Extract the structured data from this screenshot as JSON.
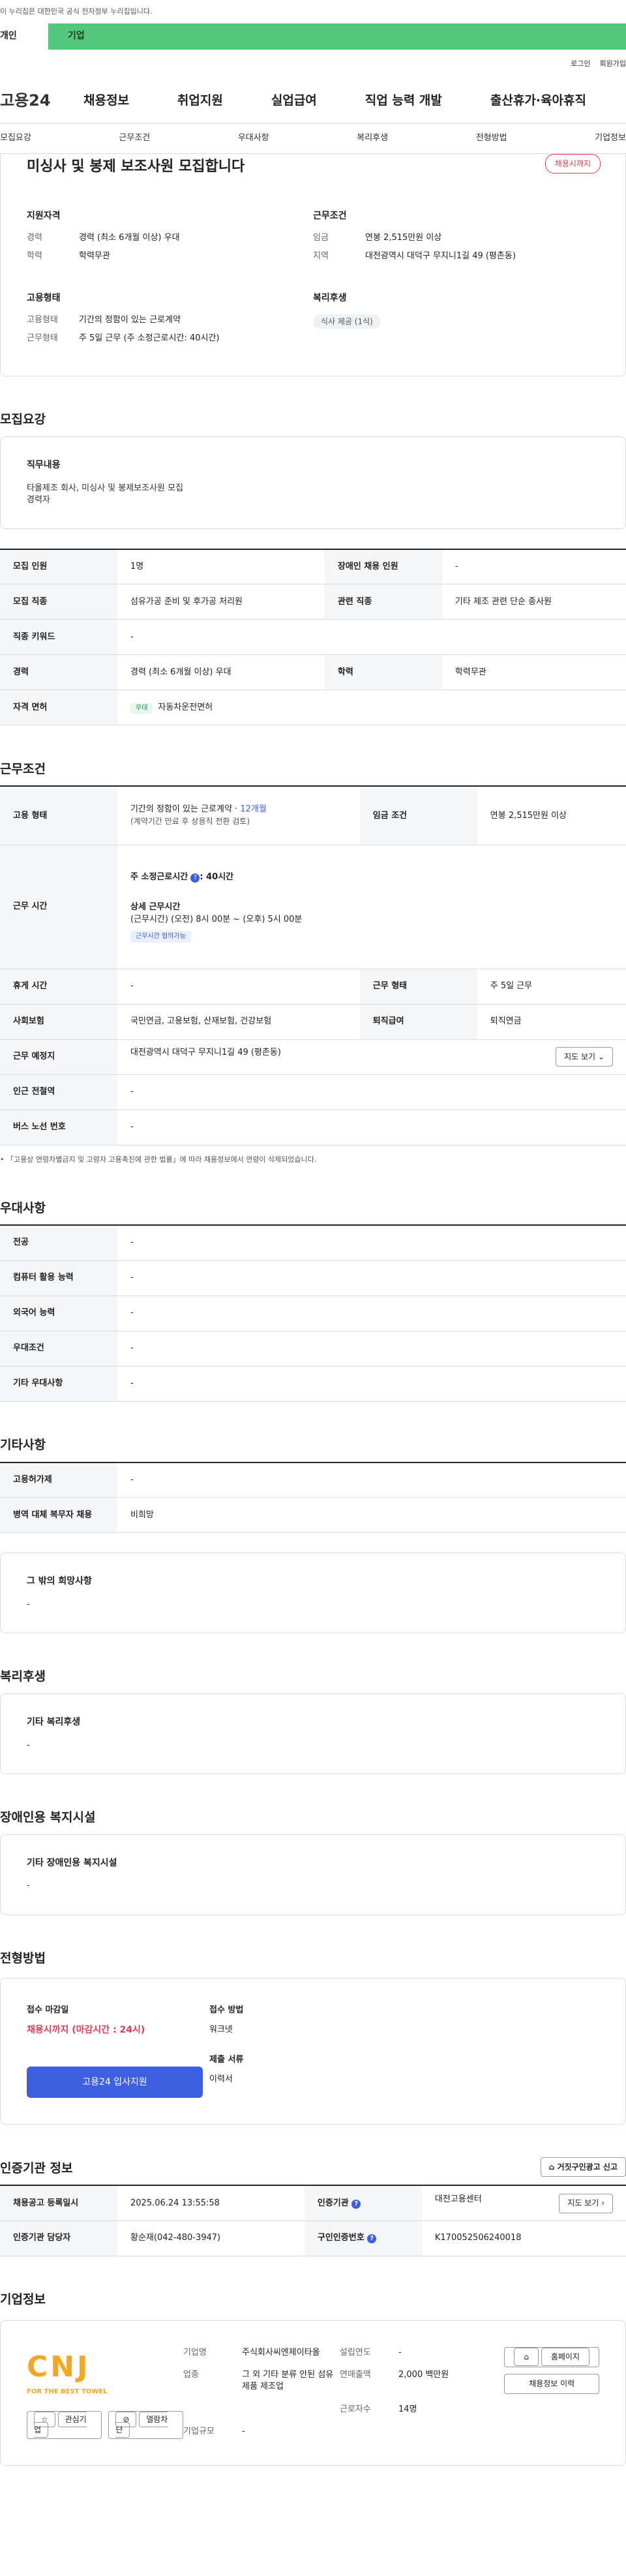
{
  "notice": "이 누리집은 대한민국 공식 전자정부 누리집입니다.",
  "tabs": [
    "개인",
    "기업"
  ],
  "util": {
    "login": "로그인",
    "join": "회원가입"
  },
  "gnb": {
    "logo": "고용24",
    "items": [
      "채용정보",
      "취업지원",
      "실업급여",
      "직업 능력 개발",
      "출산휴가·육아휴직"
    ]
  },
  "secnav": [
    "모집요강",
    "근무조건",
    "우대사항",
    "복리후생",
    "전형방법",
    "기업정보"
  ],
  "summary": {
    "title": "미싱사 및 봉제 보조사원 모집합니다",
    "badge": "채용시까지",
    "qual_title": "지원자격",
    "qual": [
      {
        "k": "경력",
        "v": "경력 (최소 6개월 이상) 우대"
      },
      {
        "k": "학력",
        "v": "학력무관"
      }
    ],
    "work_title": "근무조건",
    "work": [
      {
        "k": "임금",
        "v": "연봉 2,515만원 이상"
      },
      {
        "k": "지역",
        "v": "대전광역시 대덕구 무지니1길 49 (평촌동)"
      }
    ],
    "emp_title": "고용형태",
    "emp": [
      {
        "k": "고용형태",
        "v": "기간의 정함이 있는 근로계약"
      },
      {
        "k": "근무형태",
        "v": "주 5일 근무 (주 소정근로시간: 40시간)"
      }
    ],
    "welfare_title": "복리후생",
    "welfare_chip": "식사 제공 (1식)"
  },
  "recruit": {
    "heading": "모집요강",
    "duty_title": "직무내용",
    "duty_lines": [
      "타올제조 회사, 미싱사 및 봉제보조사원 모집",
      "경력자"
    ],
    "rows": [
      [
        {
          "k": "모집 인원",
          "v": "1명"
        },
        {
          "k": "장애인 채용 인원",
          "v": "-"
        }
      ],
      [
        {
          "k": "모집 직종",
          "v": "섬유가공 준비 및 후가공 처리원"
        },
        {
          "k": "관련 직종",
          "v": "기타 제조 관련 단순 종사원"
        }
      ],
      [
        {
          "k": "직종 키워드",
          "v": "-"
        }
      ],
      [
        {
          "k": "경력",
          "v": "경력 (최소 6개월 이상) 우대"
        },
        {
          "k": "학력",
          "v": "학력무관"
        }
      ],
      [
        {
          "k": "자격 면허",
          "v": "자동차운전면허",
          "tag": "우대"
        }
      ]
    ]
  },
  "conditions": {
    "heading": "근무조건",
    "emp_type_k": "고용 형태",
    "emp_type_v": "기간의 정함이 있는 근로계약 · ",
    "emp_type_link": "12개월",
    "emp_type_note": "(계약기간 만료 후 상용직 전환 검토)",
    "wage_k": "임금 조건",
    "wage_v": "연봉 2,515만원 이상",
    "hours_k": "근무 시간",
    "hours_main": "주 소정근로시간",
    "hours_main_v": ": 40시간",
    "hours_detail_t": "상세 근무시간",
    "hours_detail_v": "(근무시간) (오전) 8시 00분 ~ (오후) 5시 00분",
    "hours_tag": "근무시간 협의가능",
    "rest_k": "휴게 시간",
    "rest_v": "-",
    "form_k": "근무 형태",
    "form_v": "주 5일 근무",
    "ins_k": "사회보험",
    "ins_v": "국민연금, 고용보험, 산재보험, 건강보험",
    "ret_k": "퇴직급여",
    "ret_v": "퇴직연금",
    "loc_k": "근무 예정지",
    "loc_v": "대전광역시 대덕구 무지니1길 49 (평촌동)",
    "map_btn": "지도 보기",
    "sub_k": "인근 전철역",
    "sub_v": "-",
    "bus_k": "버스 노선 번호",
    "bus_v": "-",
    "note": "「고용상 연령차별금지 및 고령자 고용촉진에 관한 법률」에 따라 채용정보에서 연령이 삭제되었습니다."
  },
  "pref": {
    "heading": "우대사항",
    "rows": [
      {
        "k": "전공",
        "v": "-"
      },
      {
        "k": "컴퓨터 활용 능력",
        "v": "-"
      },
      {
        "k": "외국어 능력",
        "v": "-"
      },
      {
        "k": "우대조건",
        "v": "-"
      },
      {
        "k": "기타 우대사항",
        "v": "-"
      }
    ]
  },
  "etc": {
    "heading": "기타사항",
    "rows": [
      {
        "k": "고용허가제",
        "v": "-"
      },
      {
        "k": "병역 대체 복무자 채용",
        "v": "비희망"
      }
    ],
    "box_title": "그 밖의 희망사항",
    "box_value": "-"
  },
  "welfare": {
    "heading": "복리후생",
    "box_title": "기타 복리후생",
    "box_value": "-"
  },
  "disabled": {
    "heading": "장애인용 복지시설",
    "box_title": "기타 장애인용 복지시설",
    "box_value": "-"
  },
  "process": {
    "heading": "전형방법",
    "deadline_t": "접수 마감일",
    "deadline_v": "채용시까지 (마감시간 : 24시)",
    "method_t": "접수 방법",
    "method_v": "워크넷",
    "docs_t": "제출 서류",
    "docs_v": "이력서",
    "apply_btn": "고용24 입사지원"
  },
  "cert": {
    "heading": "인증기관 정보",
    "report_btn": "거짓구인광고 신고",
    "rows": [
      [
        {
          "k": "채용공고 등록일시",
          "v": "2025.06.24 13:55:58"
        },
        {
          "k": "인증기관",
          "v": "대전고용센터"
        }
      ],
      [
        {
          "k": "인증기관 담당자",
          "v": "황순재(042-480-3947)"
        },
        {
          "k": "구인인증번호",
          "v": "K170052506240018"
        }
      ]
    ],
    "map_btn": "지도 보기"
  },
  "company": {
    "heading": "기업정보",
    "logo_text": "CNJ",
    "logo_sub": "FOR THE BEST TOWEL",
    "fav": "관심기업",
    "block": "열람차단",
    "info": [
      {
        "k": "기업명",
        "v": "주식회사씨엔제이타올"
      },
      {
        "k": "설립연도",
        "v": "-"
      },
      {
        "k": "업종",
        "v": "그 외 기타 분류 안된 섬유제품 제조업"
      },
      {
        "k": "연매출액",
        "v": "2,000 백만원"
      },
      {
        "k": "",
        "v": ""
      },
      {
        "k": "근로자수",
        "v": "14명"
      },
      {
        "k": "기업규모",
        "v": "-"
      },
      {
        "k": "",
        "v": ""
      }
    ],
    "home_btn": "홈페이지",
    "hist_btn": "채용정보 이력"
  }
}
